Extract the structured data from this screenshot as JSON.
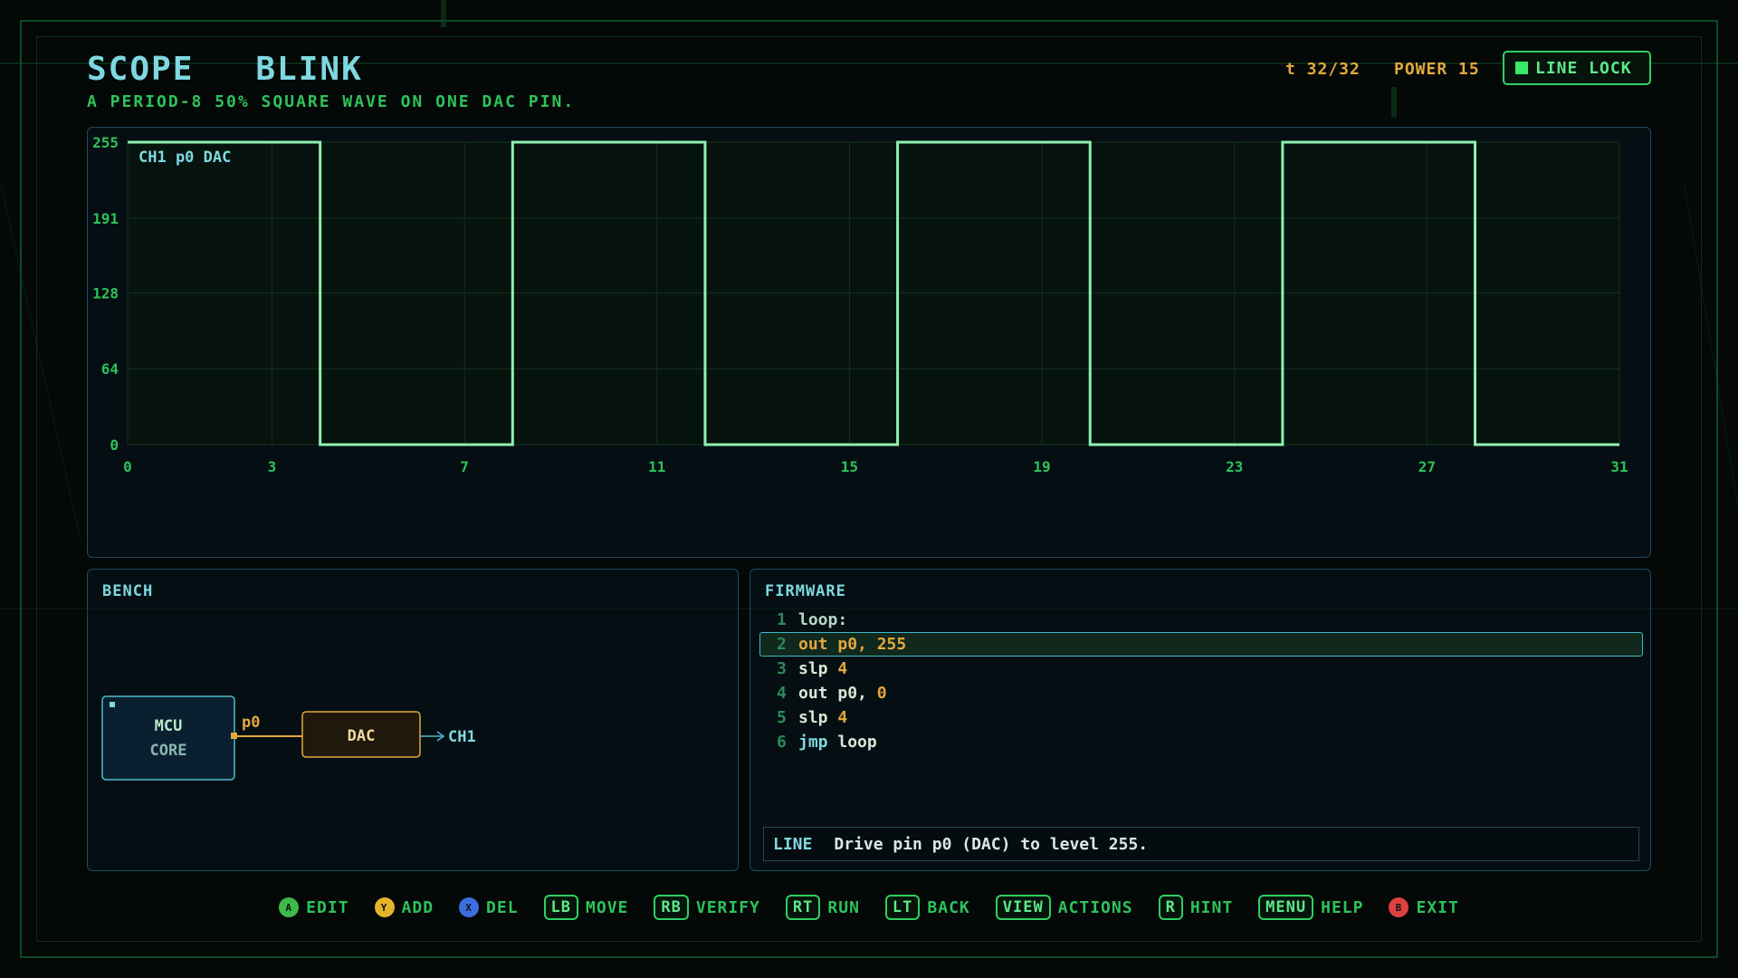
{
  "header": {
    "title_left": "SCOPE",
    "title_right": "BLINK",
    "subtitle": "A PERIOD-8 50% SQUARE WAVE ON ONE DAC PIN.",
    "time": "t 32/32",
    "power": "POWER 15",
    "line_lock": "LINE LOCK"
  },
  "scope": {
    "channel_label": "CH1 p0 DAC"
  },
  "chart_data": {
    "type": "line",
    "series": [
      {
        "name": "CH1 p0 DAC",
        "x": [
          0,
          4,
          4,
          8,
          8,
          12,
          12,
          16,
          16,
          20,
          20,
          24,
          24,
          28,
          28,
          31
        ],
        "values": [
          255,
          255,
          0,
          0,
          255,
          255,
          0,
          0,
          255,
          255,
          0,
          0,
          255,
          255,
          0,
          0
        ]
      }
    ],
    "xlim": [
      0,
      31
    ],
    "ylim": [
      0,
      255
    ],
    "yticks": [
      0,
      64,
      128,
      191,
      255
    ],
    "xticks": [
      0,
      3,
      7,
      11,
      15,
      19,
      23,
      27,
      31
    ],
    "grid": true,
    "color": "#8ff0b0"
  },
  "bench": {
    "title": "BENCH",
    "mcu_line1": "MCU",
    "mcu_line2": "CORE",
    "pin": "p0",
    "dac": "DAC",
    "out": "CH1"
  },
  "firmware": {
    "title": "FIRMWARE",
    "lines": [
      {
        "n": "1",
        "parts": [
          {
            "t": "loop:",
            "c": "lbl"
          }
        ]
      },
      {
        "n": "2",
        "parts": [
          {
            "t": "out ",
            "c": "num"
          },
          {
            "t": "p0, 255",
            "c": "num"
          }
        ],
        "selected": true
      },
      {
        "n": "3",
        "parts": [
          {
            "t": "slp ",
            "c": "plain"
          },
          {
            "t": "4",
            "c": "num"
          }
        ]
      },
      {
        "n": "4",
        "parts": [
          {
            "t": "out ",
            "c": "plain"
          },
          {
            "t": "p0, ",
            "c": "plain"
          },
          {
            "t": "0",
            "c": "num"
          }
        ]
      },
      {
        "n": "5",
        "parts": [
          {
            "t": "slp ",
            "c": "plain"
          },
          {
            "t": "4",
            "c": "num"
          }
        ]
      },
      {
        "n": "6",
        "parts": [
          {
            "t": "jmp ",
            "c": "kw"
          },
          {
            "t": "loop",
            "c": "plain"
          }
        ]
      }
    ],
    "status_tag": "LINE",
    "status_text": "Drive pin p0 (DAC) to level 255."
  },
  "footer": {
    "hints": [
      {
        "type": "circle",
        "glyph": "A",
        "color": "#3dbb4a",
        "label": "EDIT"
      },
      {
        "type": "circle",
        "glyph": "Y",
        "color": "#e3b42a",
        "label": "ADD"
      },
      {
        "type": "circle",
        "glyph": "X",
        "color": "#3a6fe0",
        "label": "DEL"
      },
      {
        "type": "key",
        "glyph": "LB",
        "label": "MOVE"
      },
      {
        "type": "key",
        "glyph": "RB",
        "label": "VERIFY"
      },
      {
        "type": "key",
        "glyph": "RT",
        "label": "RUN"
      },
      {
        "type": "key",
        "glyph": "LT",
        "label": "BACK"
      },
      {
        "type": "key",
        "glyph": "VIEW",
        "label": "ACTIONS"
      },
      {
        "type": "key",
        "glyph": "R",
        "label": "HINT"
      },
      {
        "type": "key",
        "glyph": "MENU",
        "label": "HELP"
      },
      {
        "type": "circle",
        "glyph": "B",
        "color": "#e04040",
        "label": "EXIT"
      }
    ]
  }
}
